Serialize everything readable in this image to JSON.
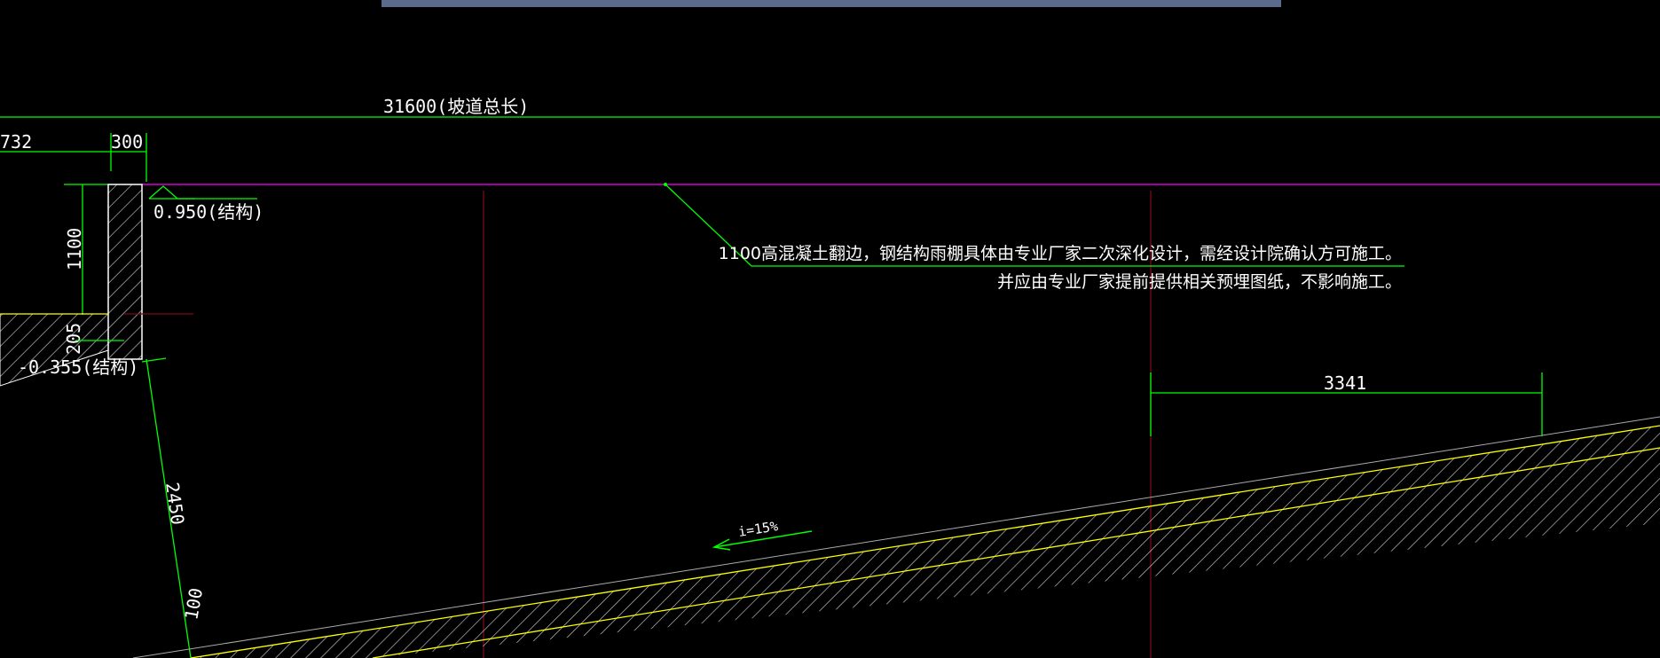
{
  "drawing": {
    "dim_total_length": "31600(坡道总长)",
    "dim_left_partial": "732",
    "dim_wall_width": "300",
    "dim_wall_height": "1100",
    "dim_step": "205",
    "dim_slope_height": "2450",
    "dim_bottom": "100",
    "dim_horizontal": "3341",
    "elev_top": "0.950(结构)",
    "elev_bottom": "-0.355(结构)",
    "slope_label": "i=15%",
    "note_line1": "1100高混凝土翻边，钢结构雨棚具体由专业厂家二次深化设计，需经设计院确认方可施工。",
    "note_line2": "并应由专业厂家提前提供相关预埋图纸，不影响施工。"
  },
  "colors": {
    "background": "#000000",
    "dimension": "#00ff00",
    "magenta_line": "#ff00ff",
    "axis_line": "#7a0a1a",
    "slab_edge": "#ffff00",
    "hatch": "#c8c8c8",
    "text": "#ffffff",
    "top_bar": "#5b6b8e"
  }
}
